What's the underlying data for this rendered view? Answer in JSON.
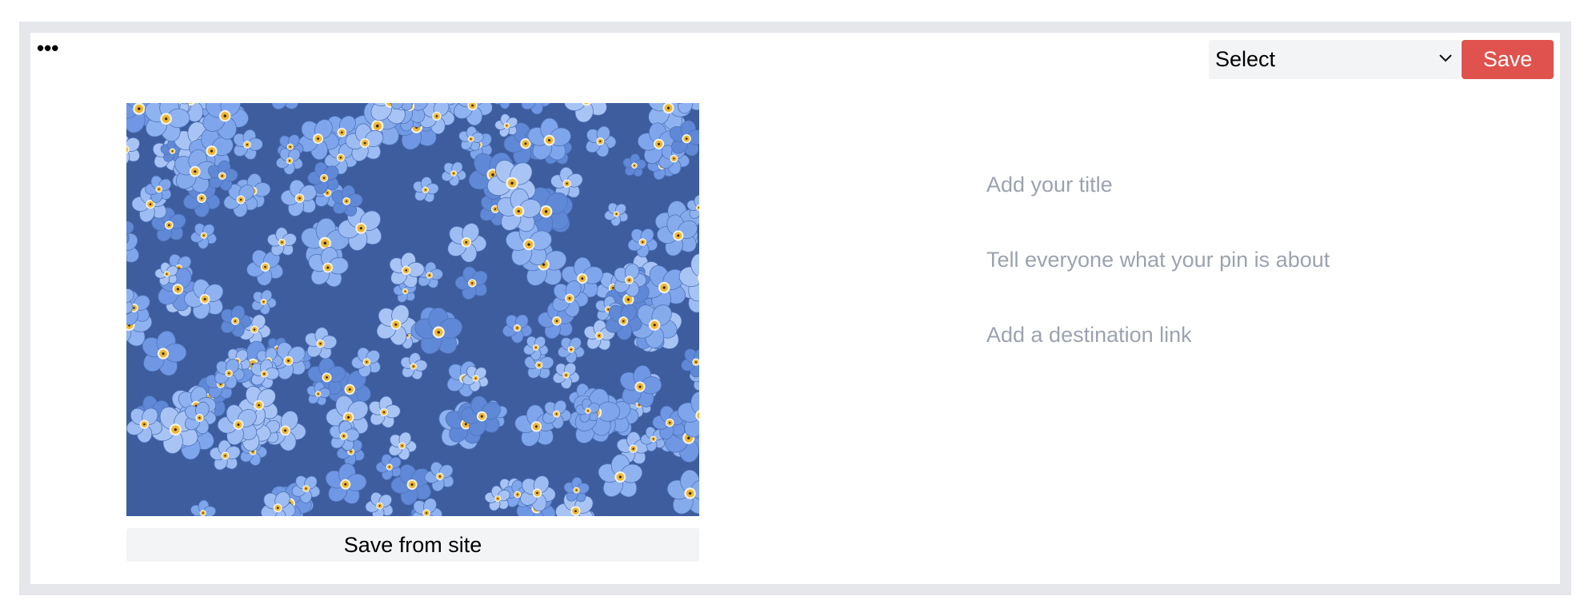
{
  "toolbar": {
    "more_label": "•••",
    "board_select": {
      "selected": "Select"
    },
    "save_label": "Save"
  },
  "pin": {
    "save_from_site_label": "Save from site",
    "title_placeholder": "Add your title",
    "description_placeholder": "Tell everyone what your pin is about",
    "link_placeholder": "Add a destination link"
  },
  "colors": {
    "accent": "#e0524d",
    "frame": "#e5e7eb",
    "field_bg": "#f3f4f6",
    "placeholder": "#9ca3af"
  },
  "icons": {
    "more": "more-horizontal-icon",
    "select_chevron": "chevron-down-icon"
  }
}
